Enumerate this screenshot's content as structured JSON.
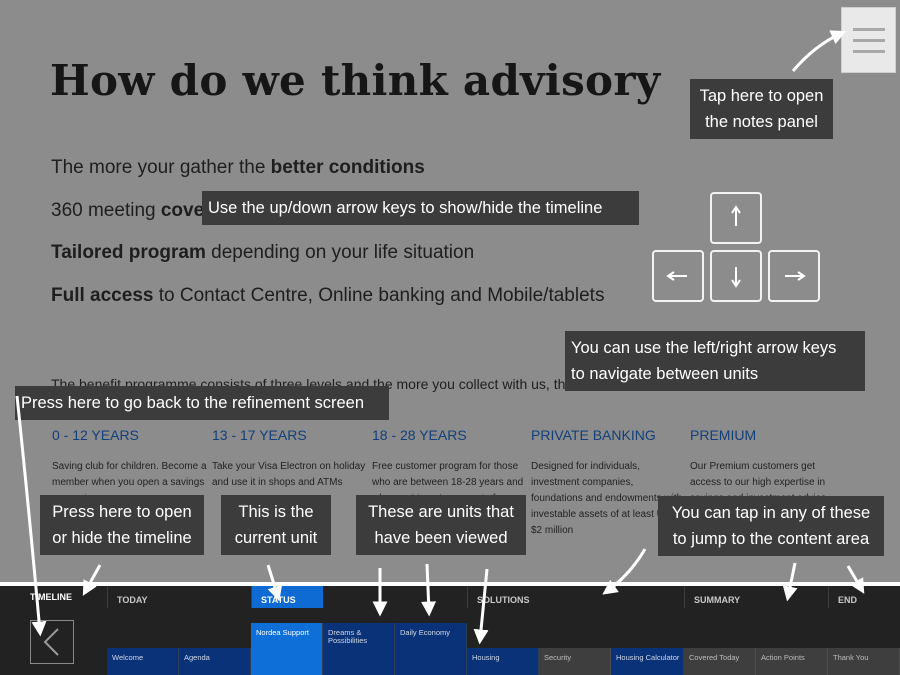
{
  "slide": {
    "title": "How do we think advisory",
    "bullets": [
      {
        "normal_before": "The more your gather the ",
        "bold": "better conditions",
        "normal_after": ""
      },
      {
        "normal_before": "360 meeting ",
        "bold": "cover",
        "normal_after": ""
      },
      {
        "normal_before": "",
        "bold": "Tailored program",
        "normal_after": " depending on your life situation"
      },
      {
        "normal_before": "",
        "bold": "Full access",
        "normal_after": " to Contact Centre, Online banking and Mobile/tablets"
      }
    ],
    "intro": "The benefit programme consists of three levels and the more you collect with us, the better the conditions will be:",
    "levels": [
      {
        "heading": "0 - 12 YEARS",
        "text": "Saving club for children. Become a member when you open a savings account"
      },
      {
        "heading": "13 - 17 YEARS",
        "text": "Take your Visa Electron on holiday and use it in shops and ATMs"
      },
      {
        "heading": "18 - 28 YEARS",
        "text": "Free customer program for those who are between 18-28 years and who want to get more out of"
      },
      {
        "heading": "PRIVATE BANKING",
        "text": "Designed for individuals, investment companies, foundations and endowments with investable assets of at least U.S. $2 million"
      },
      {
        "heading": "PREMIUM",
        "text": "Our Premium customers get access to our high expertise in savings and investment advice."
      }
    ]
  },
  "tips": {
    "notes": "Tap here to open\nthe notes panel",
    "updown": "Use the up/down arrow keys to show/hide the timeline",
    "leftright": "You can use the left/right arrow keys\nto navigate between units",
    "refine": "Press here to go back to the refinement screen",
    "toggle": "Press here to open\nor hide the timeline",
    "current": "This is the\ncurrent unit",
    "viewed": "These are units that\nhave been viewed",
    "jump": "You can tap in any of these\nto jump to the content area"
  },
  "icons": {
    "notes": "hamburger-menu-icon",
    "up": "arrow-up-icon",
    "down": "arrow-down-icon",
    "left": "arrow-left-icon",
    "right": "arrow-right-icon",
    "back": "chevron-left-icon"
  },
  "timeline": {
    "label": "TIMELINE",
    "sections": [
      "TODAY",
      "STATUS",
      "SOLUTIONS",
      "SUMMARY",
      "END"
    ],
    "status_units": [
      "Nordea Support",
      "Dreams & Possibilities",
      "Daily Economy"
    ],
    "bottom_units": [
      "Welcome",
      "Agenda",
      "",
      "",
      "",
      "Housing",
      "Security",
      "Housing Calculator",
      "Covered Today",
      "Action Points",
      "Thank You"
    ]
  },
  "colors": {
    "background": "#8c8c8c",
    "tooltip": "#3c3c3c",
    "accent_blue": "#0e6bd3",
    "viewed_blue": "#0a3278",
    "heading_blue": "#133f7a"
  }
}
